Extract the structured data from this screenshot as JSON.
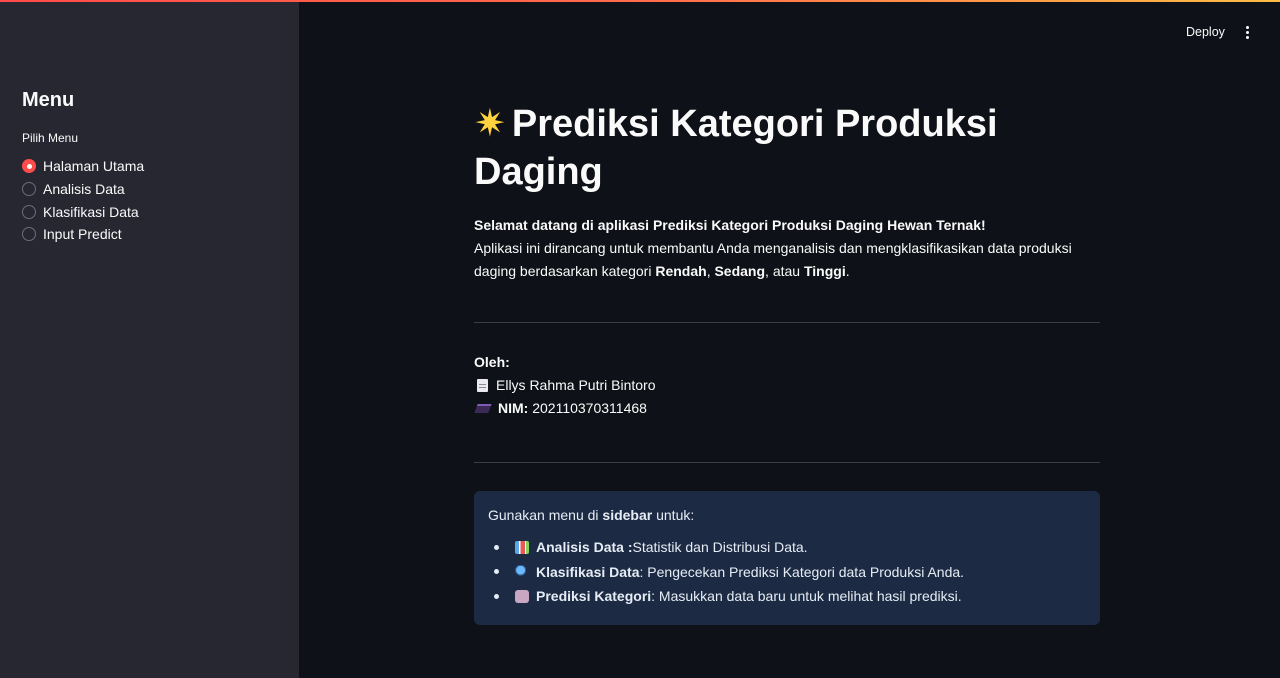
{
  "header": {
    "deploy_label": "Deploy",
    "more_icon": "kebab-icon"
  },
  "sidebar": {
    "title": "Menu",
    "radio_label": "Pilih Menu",
    "options": [
      {
        "label": "Halaman Utama",
        "selected": true
      },
      {
        "label": "Analisis Data",
        "selected": false
      },
      {
        "label": "Klasifikasi Data",
        "selected": false
      },
      {
        "label": "Input Predict",
        "selected": false
      }
    ]
  },
  "main": {
    "title_icon": "star-icon",
    "title_line1": "Prediksi Kategori Produksi",
    "title_line2": "Daging",
    "welcome": "Selamat datang di aplikasi Prediksi Kategori Produksi Daging Hewan Ternak!",
    "desc_part1": "Aplikasi ini dirancang untuk membantu Anda menganalisis dan mengklasifikasikan data produksi daging berdasarkan kategori ",
    "cat_low": "Rendah",
    "comma": ", ",
    "cat_mid": "Sedang",
    "or_text": ", atau ",
    "cat_high": "Tinggi",
    "period": ".",
    "author_label": "Oleh:",
    "author_name": "Ellys Rahma Putri Bintoro",
    "nim_label": "NIM:",
    "nim_value": "202110370311468"
  },
  "info_box": {
    "intro_prefix": "Gunakan menu di ",
    "intro_bold": "sidebar",
    "intro_suffix": " untuk:",
    "items": [
      {
        "icon": "bar-chart-icon",
        "title": "Analisis Data :",
        "desc": " Statistik dan Distribusi Data."
      },
      {
        "icon": "magnifier-icon",
        "title": "Klasifikasi Data",
        "desc": ": Pengecekan Prediksi Kategori data Produksi Anda."
      },
      {
        "icon": "robot-icon",
        "title": "Prediksi Kategori",
        "desc": ": Masukkan data baru untuk melihat hasil prediksi."
      }
    ]
  },
  "colors": {
    "accent": "#ff4b4b",
    "background": "#0e1117",
    "sidebar": "#262730",
    "info_box": "#1c2b43"
  }
}
